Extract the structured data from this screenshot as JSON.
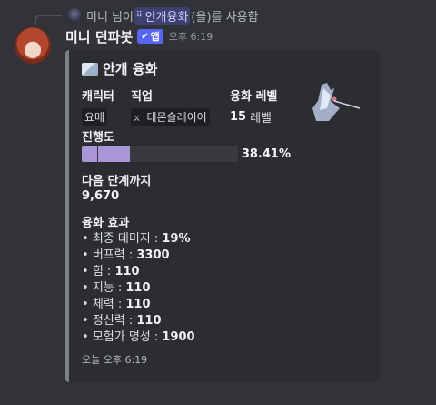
{
  "reply": {
    "prefix": "미니 님이",
    "command": "안개융화",
    "suffix": "(을)를 사용함"
  },
  "message": {
    "username": "미니 던파봇",
    "app_badge": "앱",
    "timestamp": "오후 6:19"
  },
  "embed": {
    "title": "안개 융화",
    "accent_color": "#7e8187",
    "fields": {
      "character": {
        "name": "캐릭터",
        "value": "요메"
      },
      "job": {
        "name": "직업",
        "icon": "sword-icon",
        "value": "데몬슬레이어"
      },
      "level": {
        "name": "융화 레벨",
        "value": "15",
        "unit": "레벨"
      }
    },
    "progress": {
      "label": "진행도",
      "percent_text": "38.41%",
      "value": 0.3841,
      "filled_segments": 3,
      "total_segments": 10,
      "fill_color": "#a996d6"
    },
    "next_step": {
      "label": "다음 단계까지",
      "value": "9,670"
    },
    "effects": {
      "label": "융화 효과",
      "items": [
        {
          "name": "최종 데미지",
          "value": "19%"
        },
        {
          "name": "버프력",
          "value": "3300"
        },
        {
          "name": "힘",
          "value": "110"
        },
        {
          "name": "지능",
          "value": "110"
        },
        {
          "name": "체력",
          "value": "110"
        },
        {
          "name": "정신력",
          "value": "110"
        },
        {
          "name": "모험가 명성",
          "value": "1900"
        }
      ]
    },
    "footer": "오늘 오후 6:19"
  }
}
